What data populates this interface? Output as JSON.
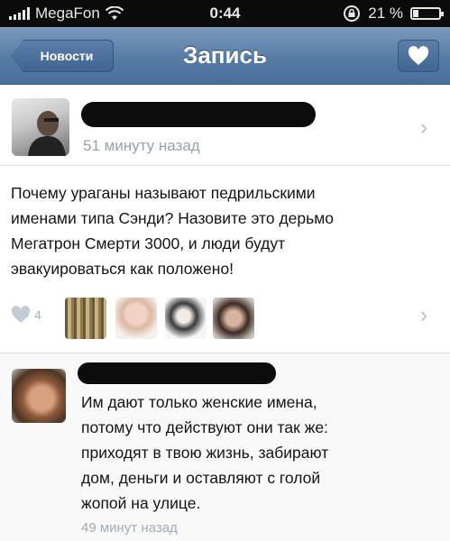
{
  "status_bar": {
    "carrier": "MegaFon",
    "time": "0:44",
    "battery_percent": "21 %",
    "battery_level": 0.21
  },
  "nav": {
    "back_label": "Новости",
    "title": "Запись",
    "like_icon": "heart-icon"
  },
  "post": {
    "time_ago": "51 минуту назад",
    "text_lines": [
      "Почему ураганы называют педрильскими",
      "именами типа Сэнди? Назовите это дерьмо",
      "Мегатрон Смерти 3000, и люди будут",
      "эвакуироваться как положено!"
    ],
    "likes_count": "4"
  },
  "comment": {
    "text_lines": [
      "Им дают только женские имена,",
      "потому что действуют они так же:",
      "приходят в твою жизнь, забирают",
      "дом, деньги и оставляют с голой",
      "жопой на улице."
    ],
    "time_ago": "49 минут назад"
  },
  "colors": {
    "nav_bar": "#557aa3",
    "meta_text": "#97a0ab",
    "redaction": "#0c0c0c"
  }
}
